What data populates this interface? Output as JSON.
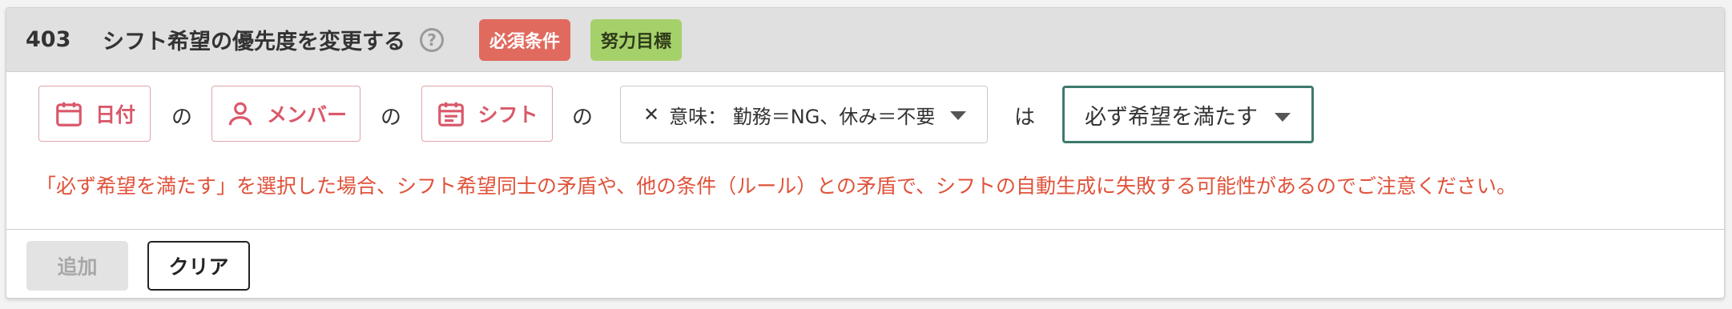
{
  "rule": {
    "number": "403",
    "title": "シフト希望の優先度を変更する",
    "help_icon": "question-circle-icon",
    "tags": {
      "required": "必須条件",
      "effort": "努力目標"
    }
  },
  "condition": {
    "date_chip": {
      "label": "日付",
      "icon": "calendar-icon"
    },
    "member_chip": {
      "label": "メンバー",
      "icon": "person-icon"
    },
    "shift_chip": {
      "label": "シフト",
      "icon": "calendar-list-icon"
    },
    "connector_no": "の",
    "meaning_select": {
      "prefix": "✕",
      "value": "意味： 勤務＝NG、休み＝不要"
    },
    "connector_wa": "は",
    "priority_select": {
      "value": "必ず希望を満たす"
    }
  },
  "warning": "「必ず希望を満たす」を選択した場合、シフト希望同士の矛盾や、他の条件（ルール）との矛盾で、シフトの自動生成に失敗する可能性があるのでご注意ください。",
  "actions": {
    "add_label": "追加",
    "clear_label": "クリア"
  },
  "colors": {
    "accent_red": "#e06a5e",
    "accent_green": "#a5d16a",
    "chip_text": "#d9596a",
    "warning_text": "#e0523a",
    "select_focus_border": "#3d7a6e"
  }
}
